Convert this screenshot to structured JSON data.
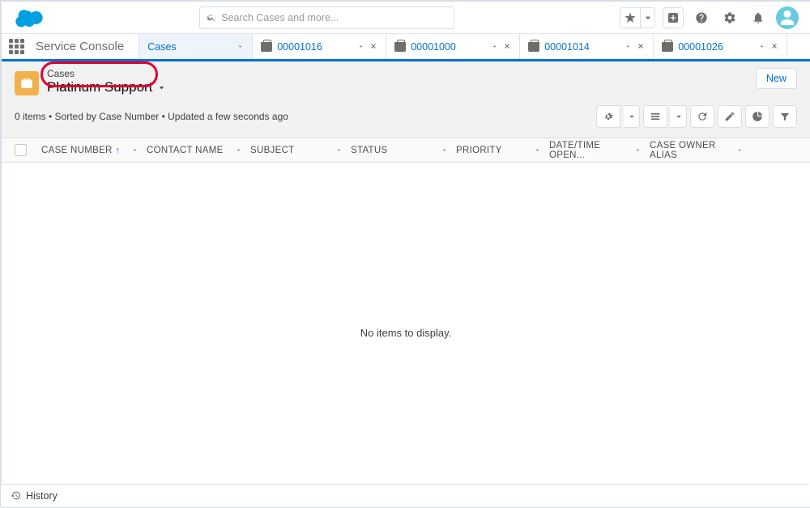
{
  "search": {
    "placeholder": "Search Cases and more..."
  },
  "app_name": "Service Console",
  "nav": {
    "workspace": "Cases",
    "records": [
      "00001016",
      "00001000",
      "00001014",
      "00001026"
    ]
  },
  "page": {
    "breadcrumb": "Cases",
    "listview_name": "Platinum Support",
    "meta": "0 items • Sorted by Case Number • Updated a few seconds ago",
    "new_btn": "New"
  },
  "columns": {
    "case_number": "CASE NUMBER",
    "contact_name": "CONTACT NAME",
    "subject": "SUBJECT",
    "status": "STATUS",
    "priority": "PRIORITY",
    "datetime": "DATE/TIME OPEN...",
    "owner": "CASE OWNER ALIAS"
  },
  "empty_msg": "No items to display.",
  "footer": {
    "history": "History"
  },
  "highlight": {
    "color": "#e2002e"
  }
}
